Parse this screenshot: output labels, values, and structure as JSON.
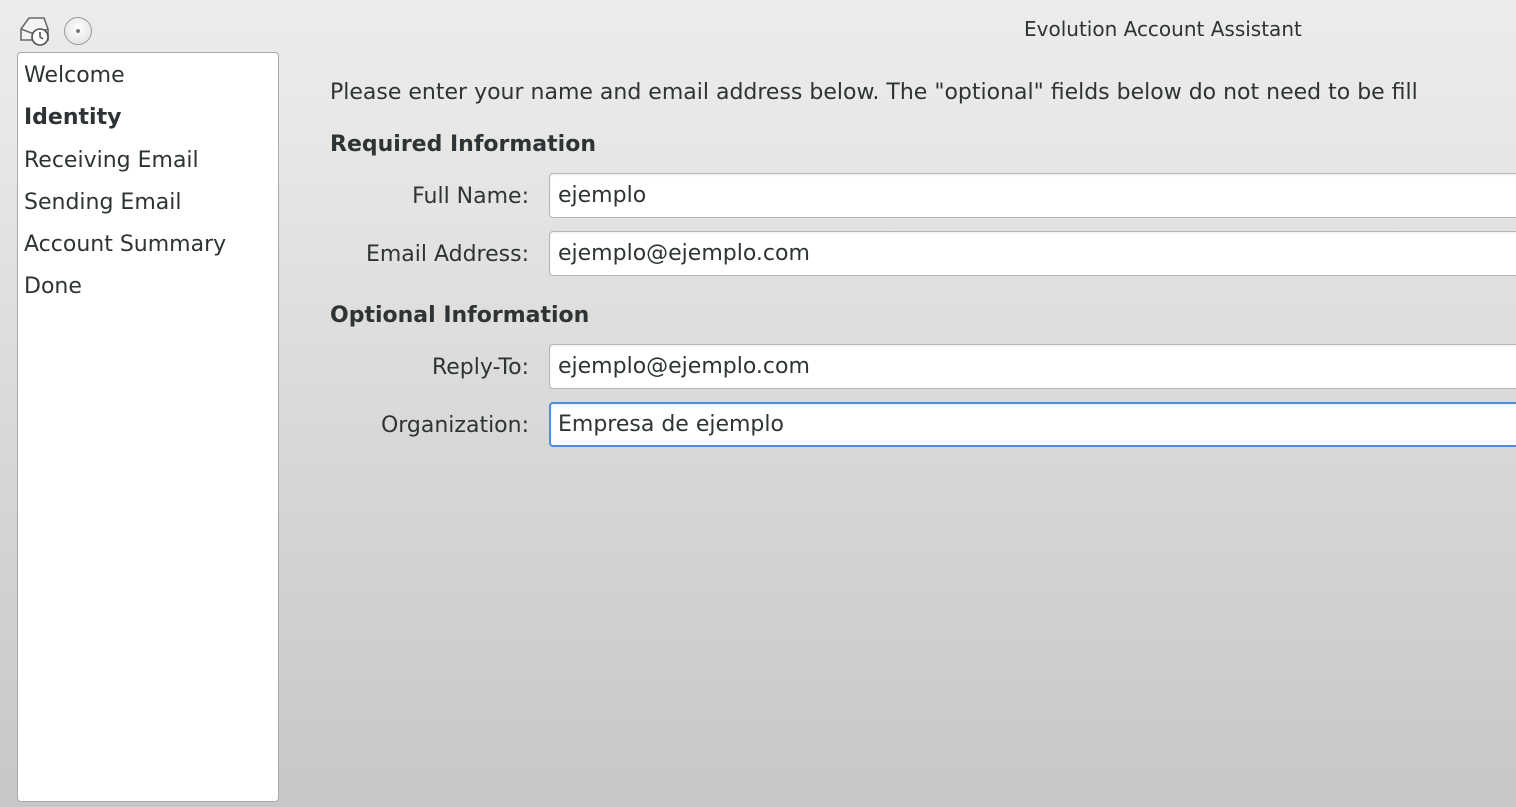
{
  "window": {
    "title": "Evolution Account Assistant",
    "app_icon": "evolution-mail-clock-icon",
    "minimize_icon": "minimize-icon"
  },
  "sidebar": {
    "items": [
      {
        "label": "Welcome",
        "active": false
      },
      {
        "label": "Identity",
        "active": true
      },
      {
        "label": "Receiving Email",
        "active": false
      },
      {
        "label": "Sending Email",
        "active": false
      },
      {
        "label": "Account Summary",
        "active": false
      },
      {
        "label": "Done",
        "active": false
      }
    ]
  },
  "main": {
    "intro": "Please enter your name and email address below. The \"optional\" fields below do not need to be fill",
    "required": {
      "heading": "Required Information",
      "full_name": {
        "label": "Full Name:",
        "value": "ejemplo"
      },
      "email": {
        "label": "Email Address:",
        "value": "ejemplo@ejemplo.com"
      }
    },
    "optional": {
      "heading": "Optional Information",
      "reply_to": {
        "label": "Reply-To:",
        "value": "ejemplo@ejemplo.com"
      },
      "organization": {
        "label": "Organization:",
        "value": "Empresa de ejemplo"
      }
    }
  },
  "colors": {
    "focus_border": "#4a90d9",
    "text": "#2e3436"
  }
}
